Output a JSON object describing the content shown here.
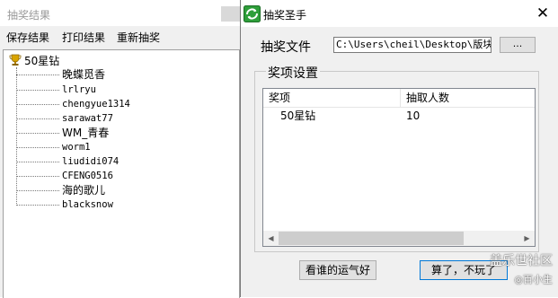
{
  "results_window": {
    "title": "抽奖结果",
    "menu": [
      "保存结果",
      "打印结果",
      "重新抽奖"
    ],
    "tree": {
      "root_label": "50星钻",
      "items": [
        "晚蝶觅香",
        "lrlryu",
        "chengyue1314",
        "sarawat77",
        "WM_青春",
        "worm1",
        "liudidi074",
        "CFENG0516",
        "海的歌儿",
        "blacksnow"
      ]
    }
  },
  "dialog": {
    "title": "抽奖圣手",
    "file_label": "抽奖文件",
    "file_path": "C:\\Users\\cheil\\Desktop\\版块活",
    "browse_label": "...",
    "group_label": "奖项设置",
    "columns": [
      "奖项",
      "抽取人数"
    ],
    "rows": [
      {
        "prize": "50星钻",
        "count": "10"
      }
    ],
    "lucky_button": "看谁的运气好",
    "quit_button": "算了，不玩了"
  },
  "watermark": {
    "line1": "盖乐世社区",
    "line2": "◎百小生"
  },
  "icons": {
    "root": "trophy-icon",
    "app": "app-icon",
    "close": "close-icon"
  },
  "colors": {
    "focus_border": "#0078d7",
    "window_bg": "#f0f0f0"
  }
}
